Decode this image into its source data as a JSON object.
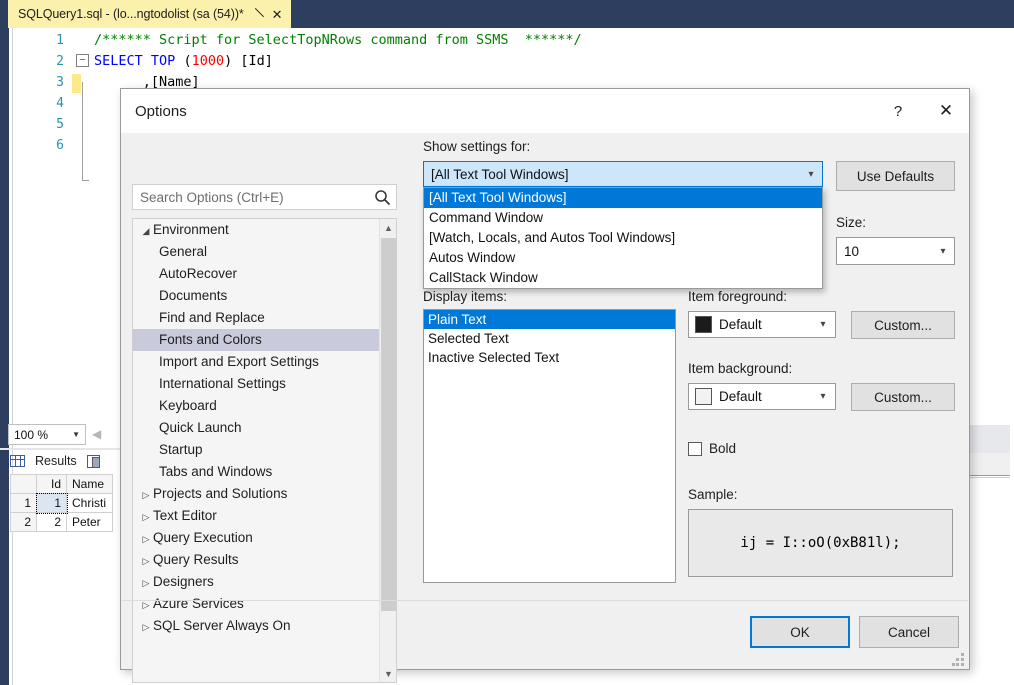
{
  "editor": {
    "tab_title": "SQLQuery1.sql - (lo...ngtodolist (sa (54))*",
    "pin_icon": "pin-icon",
    "close_icon": "close-icon",
    "lines": [
      {
        "num": "1",
        "segments": [
          {
            "text": "/****** Script for SelectTopNRows command from SSMS  ******/",
            "cls": "c-comment"
          }
        ]
      },
      {
        "num": "2",
        "segments": [
          {
            "text": "SELECT",
            "cls": "c-key"
          },
          {
            "text": " ",
            "cls": "c-plain"
          },
          {
            "text": "TOP",
            "cls": "c-key"
          },
          {
            "text": " (",
            "cls": "c-plain"
          },
          {
            "text": "1000",
            "cls": "c-num"
          },
          {
            "text": ") [Id]",
            "cls": "c-plain"
          }
        ]
      },
      {
        "num": "3",
        "segments": [
          {
            "text": "      ,[Name]",
            "cls": "c-plain"
          }
        ]
      },
      {
        "num": "4",
        "segments": []
      },
      {
        "num": "5",
        "segments": []
      },
      {
        "num": "6",
        "segments": []
      }
    ],
    "zoom_level": "100 %",
    "results_tab": "Results",
    "grid": {
      "columns": [
        "",
        "Id",
        "Name"
      ],
      "rows": [
        [
          "1",
          "1",
          "Christi"
        ],
        [
          "2",
          "2",
          "Peter"
        ]
      ]
    }
  },
  "dialog": {
    "title": "Options",
    "help_icon": "?",
    "close_icon": "✕",
    "search": {
      "placeholder": "Search Options (Ctrl+E)",
      "value": "",
      "icon": "search-icon"
    },
    "tree": [
      {
        "label": "Environment",
        "level": 0,
        "twisty": "◢",
        "selected": false
      },
      {
        "label": "General",
        "level": 1,
        "twisty": "",
        "selected": false
      },
      {
        "label": "AutoRecover",
        "level": 1,
        "twisty": "",
        "selected": false
      },
      {
        "label": "Documents",
        "level": 1,
        "twisty": "",
        "selected": false
      },
      {
        "label": "Find and Replace",
        "level": 1,
        "twisty": "",
        "selected": false
      },
      {
        "label": "Fonts and Colors",
        "level": 1,
        "twisty": "",
        "selected": true
      },
      {
        "label": "Import and Export Settings",
        "level": 1,
        "twisty": "",
        "selected": false
      },
      {
        "label": "International Settings",
        "level": 1,
        "twisty": "",
        "selected": false
      },
      {
        "label": "Keyboard",
        "level": 1,
        "twisty": "▷",
        "selected": false
      },
      {
        "label": "Quick Launch",
        "level": 1,
        "twisty": "",
        "selected": false
      },
      {
        "label": "Startup",
        "level": 1,
        "twisty": "",
        "selected": false
      },
      {
        "label": "Tabs and Windows",
        "level": 1,
        "twisty": "",
        "selected": false
      },
      {
        "label": "Projects and Solutions",
        "level": 0,
        "twisty": "▷",
        "selected": false
      },
      {
        "label": "Text Editor",
        "level": 0,
        "twisty": "▷",
        "selected": false
      },
      {
        "label": "Query Execution",
        "level": 0,
        "twisty": "▷",
        "selected": false
      },
      {
        "label": "Query Results",
        "level": 0,
        "twisty": "▷",
        "selected": false
      },
      {
        "label": "Designers",
        "level": 0,
        "twisty": "▷",
        "selected": false
      },
      {
        "label": "Azure Services",
        "level": 0,
        "twisty": "▷",
        "selected": false
      },
      {
        "label": "SQL Server Always On",
        "level": 0,
        "twisty": "▷",
        "selected": false
      }
    ],
    "show_settings_label": "Show settings for:",
    "settings_combo_value": "[All Text Tool Windows]",
    "settings_dropdown_options": [
      {
        "label": "[All Text Tool Windows]",
        "selected": true
      },
      {
        "label": "Command Window",
        "selected": false
      },
      {
        "label": "[Watch, Locals, and Autos Tool Windows]",
        "selected": false
      },
      {
        "label": "Autos Window",
        "selected": false
      },
      {
        "label": "CallStack Window",
        "selected": false
      }
    ],
    "use_defaults_label": "Use Defaults",
    "size_label": "Size:",
    "size_value": "10",
    "display_items_label": "Display items:",
    "display_items": [
      {
        "label": "Plain Text",
        "selected": true
      },
      {
        "label": "Selected Text",
        "selected": false
      },
      {
        "label": "Inactive Selected Text",
        "selected": false
      }
    ],
    "item_foreground_label": "Item foreground:",
    "item_foreground_value": "Default",
    "item_foreground_swatch": "#1b1b1b",
    "item_background_label": "Item background:",
    "item_background_value": "Default",
    "item_background_swatch": "#f2f2f2",
    "custom_fg_label": "Custom...",
    "custom_bg_label": "Custom...",
    "bold_label": "Bold",
    "bold_checked": false,
    "sample_label": "Sample:",
    "sample_text": "ij = I::oO(0xB81l);",
    "ok_label": "OK",
    "cancel_label": "Cancel"
  },
  "colors": {
    "accent": "#0078d7",
    "tab_yellow": "#fcf0ad",
    "topbar": "#2d3e5f",
    "tree_selection": "#c9cbdd",
    "dialog_bg": "#f0f0f0"
  }
}
